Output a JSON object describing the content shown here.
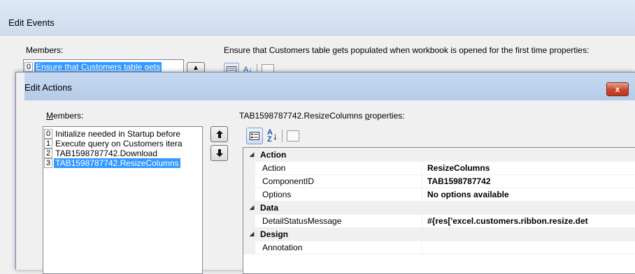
{
  "outer": {
    "title": "Edit Events",
    "members_label": "Members:",
    "list_index": "0",
    "list_item": "Ensure that Customers table gets",
    "up_arrow": "▲",
    "props_label": "Ensure that Customers table gets populated when workbook is opened for the first time properties:",
    "tb_az": "A↓"
  },
  "dialog": {
    "title": "Edit Actions",
    "close": "x",
    "members_label_prefix": "M",
    "members_label_rest": "embers:",
    "items": [
      {
        "index": "0",
        "text": "Initialize needed in Startup before"
      },
      {
        "index": "1",
        "text": "Execute query on Customers itera"
      },
      {
        "index": "2",
        "text": "TAB1598787742.Download"
      },
      {
        "index": "3",
        "text": "TAB1598787742.ResizeColumns"
      }
    ],
    "up_arrow": "🡑",
    "down_arrow": "🡓",
    "props_label_pre": "TAB1598787742.ResizeColumns ",
    "props_label_u": "p",
    "props_label_post": "roperties:",
    "az_top": "A",
    "az_bottom": "Z",
    "az_arrow": "↓"
  },
  "grid": {
    "categories": [
      {
        "name": "Action",
        "props": [
          {
            "name": "Action",
            "value": "ResizeColumns"
          },
          {
            "name": "ComponentID",
            "value": "TAB1598787742"
          },
          {
            "name": "Options",
            "value": "No options available"
          }
        ]
      },
      {
        "name": "Data",
        "props": [
          {
            "name": "DetailStatusMessage",
            "value": "#{res['excel.customers.ribbon.resize.det"
          }
        ]
      },
      {
        "name": "Design",
        "props": [
          {
            "name": "Annotation",
            "value": ""
          }
        ]
      }
    ],
    "collapse_glyph": "◢"
  },
  "colors": {
    "selection": "#3399ff",
    "close_button": "#c8452d"
  }
}
